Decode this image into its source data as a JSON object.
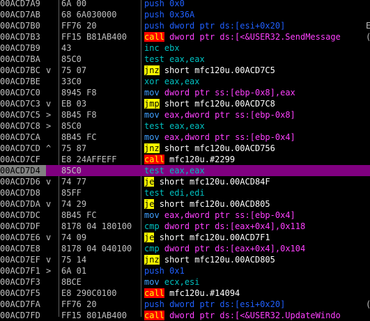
{
  "rows": [
    {
      "addr": "00ACD7A9",
      "jmark": "",
      "hex": "6A 00",
      "mn": "push",
      "mnclass": "mn-push",
      "ops": "0x0",
      "opclass": "op-push",
      "right": ""
    },
    {
      "addr": "00ACD7AB",
      "jmark": "",
      "hex": "68 6A030000",
      "mn": "push",
      "mnclass": "mn-push",
      "ops": "0x36A",
      "opclass": "op-push",
      "right": ""
    },
    {
      "addr": "00ACD7B0",
      "jmark": "",
      "hex": "FF76 20",
      "mn": "push",
      "mnclass": "mn-push",
      "ops": "dword ptr ds:[esi+0x20]",
      "opclass": "op-push",
      "right": "E"
    },
    {
      "addr": "00ACD7B3",
      "jmark": "",
      "hex": "FF15 B81AB400",
      "mn": "call",
      "mnclass": "mn-call",
      "ops": "dword ptr ds:[<&USER32.SendMessage",
      "opclass": "op-call",
      "right": "("
    },
    {
      "addr": "00ACD7B9",
      "jmark": "",
      "hex": "43",
      "mn": "inc",
      "mnclass": "mn-inc",
      "ops": "ebx",
      "opclass": "op-reg",
      "right": ""
    },
    {
      "addr": "00ACD7BA",
      "jmark": "",
      "hex": "85C0",
      "mn": "test",
      "mnclass": "mn-test",
      "ops": "eax,eax",
      "opclass": "op-reg",
      "right": ""
    },
    {
      "addr": "00ACD7BC",
      "jmark": "v",
      "hex": "75 07",
      "mn": "jnz",
      "mnclass": "mn-jcc",
      "ops": "short mfc120u.00ACD7C5",
      "opclass": "op-jmp",
      "right": ""
    },
    {
      "addr": "00ACD7BE",
      "jmark": "",
      "hex": "33C0",
      "mn": "xor",
      "mnclass": "mn-xor",
      "ops": "eax,eax",
      "opclass": "op-reg",
      "right": ""
    },
    {
      "addr": "00ACD7C0",
      "jmark": "",
      "hex": "8945 F8",
      "mn": "mov",
      "mnclass": "mn-mov",
      "ops": "dword ptr ss:[ebp-0x8],eax",
      "opclass": "op-mov",
      "right": ""
    },
    {
      "addr": "00ACD7C3",
      "jmark": "v",
      "hex": "EB 03",
      "mn": "jmp",
      "mnclass": "mn-jmp",
      "ops": "short mfc120u.00ACD7C8",
      "opclass": "op-jmp",
      "right": ""
    },
    {
      "addr": "00ACD7C5",
      "jmark": ">",
      "hex": "8B45 F8",
      "mn": "mov",
      "mnclass": "mn-mov",
      "ops": "eax,dword ptr ss:[ebp-0x8]",
      "opclass": "op-mov",
      "right": ""
    },
    {
      "addr": "00ACD7C8",
      "jmark": ">",
      "hex": "85C0",
      "mn": "test",
      "mnclass": "mn-test",
      "ops": "eax,eax",
      "opclass": "op-reg",
      "right": ""
    },
    {
      "addr": "00ACD7CA",
      "jmark": "",
      "hex": "8B45 FC",
      "mn": "mov",
      "mnclass": "mn-mov",
      "ops": "eax,dword ptr ss:[ebp-0x4]",
      "opclass": "op-mov",
      "right": ""
    },
    {
      "addr": "00ACD7CD",
      "jmark": "^",
      "hex": "75 87",
      "mn": "jnz",
      "mnclass": "mn-jcc",
      "ops": "short mfc120u.00ACD756",
      "opclass": "op-jmp",
      "right": ""
    },
    {
      "addr": "00ACD7CF",
      "jmark": "",
      "hex": "E8 24AFFEFF",
      "mn": "call",
      "mnclass": "mn-call",
      "ops": "mfc120u.#2299",
      "opclass": "op-jmp",
      "right": ""
    },
    {
      "addr": "00ACD7D4",
      "jmark": "",
      "hex": "85C0",
      "mn": "test",
      "mnclass": "mn-test",
      "ops": "eax,eax",
      "opclass": "op-reg",
      "right": "",
      "sel": true
    },
    {
      "addr": "00ACD7D6",
      "jmark": "v",
      "hex": "74 77",
      "mn": "je",
      "mnclass": "mn-jcc",
      "ops": "short mfc120u.00ACD84F",
      "opclass": "op-jmp",
      "right": ""
    },
    {
      "addr": "00ACD7D8",
      "jmark": "",
      "hex": "85FF",
      "mn": "test",
      "mnclass": "mn-test",
      "ops": "edi,edi",
      "opclass": "op-reg",
      "right": ""
    },
    {
      "addr": "00ACD7DA",
      "jmark": "v",
      "hex": "74 29",
      "mn": "je",
      "mnclass": "mn-jcc",
      "ops": "short mfc120u.00ACD805",
      "opclass": "op-jmp",
      "right": ""
    },
    {
      "addr": "00ACD7DC",
      "jmark": "",
      "hex": "8B45 FC",
      "mn": "mov",
      "mnclass": "mn-mov",
      "ops": "eax,dword ptr ss:[ebp-0x4]",
      "opclass": "op-mov",
      "right": ""
    },
    {
      "addr": "00ACD7DF",
      "jmark": "",
      "hex": "8178 04 180100",
      "mn": "cmp",
      "mnclass": "mn-cmp",
      "ops": "dword ptr ds:[eax+0x4],0x118",
      "opclass": "op-cmp",
      "right": ""
    },
    {
      "addr": "00ACD7E6",
      "jmark": "v",
      "hex": "74 09",
      "mn": "je",
      "mnclass": "mn-jcc",
      "ops": "short mfc120u.00ACD7F1",
      "opclass": "op-jmp",
      "right": ""
    },
    {
      "addr": "00ACD7E8",
      "jmark": "",
      "hex": "8178 04 040100",
      "mn": "cmp",
      "mnclass": "mn-cmp",
      "ops": "dword ptr ds:[eax+0x4],0x104",
      "opclass": "op-cmp",
      "right": ""
    },
    {
      "addr": "00ACD7EF",
      "jmark": "v",
      "hex": "75 14",
      "mn": "jnz",
      "mnclass": "mn-jcc",
      "ops": "short mfc120u.00ACD805",
      "opclass": "op-jmp",
      "right": ""
    },
    {
      "addr": "00ACD7F1",
      "jmark": ">",
      "hex": "6A 01",
      "mn": "push",
      "mnclass": "mn-push",
      "ops": "0x1",
      "opclass": "op-push",
      "right": ""
    },
    {
      "addr": "00ACD7F3",
      "jmark": "",
      "hex": "8BCE",
      "mn": "mov",
      "mnclass": "mn-mov",
      "ops": "ecx,esi",
      "opclass": "op-reg",
      "right": ""
    },
    {
      "addr": "00ACD7F5",
      "jmark": "",
      "hex": "E8 290C0100",
      "mn": "call",
      "mnclass": "mn-call",
      "ops": "mfc120u.#14094",
      "opclass": "op-jmp",
      "right": ""
    },
    {
      "addr": "00ACD7FA",
      "jmark": "",
      "hex": "FF76 20",
      "mn": "push",
      "mnclass": "mn-push",
      "ops": "dword ptr ds:[esi+0x20]",
      "opclass": "op-push",
      "right": "("
    },
    {
      "addr": "00ACD7FD",
      "jmark": "",
      "hex": "FF15 801AB400",
      "mn": "call",
      "mnclass": "mn-call",
      "ops": "dword ptr ds:[<&USER32.UpdateWindo",
      "opclass": "op-call",
      "right": ""
    }
  ]
}
